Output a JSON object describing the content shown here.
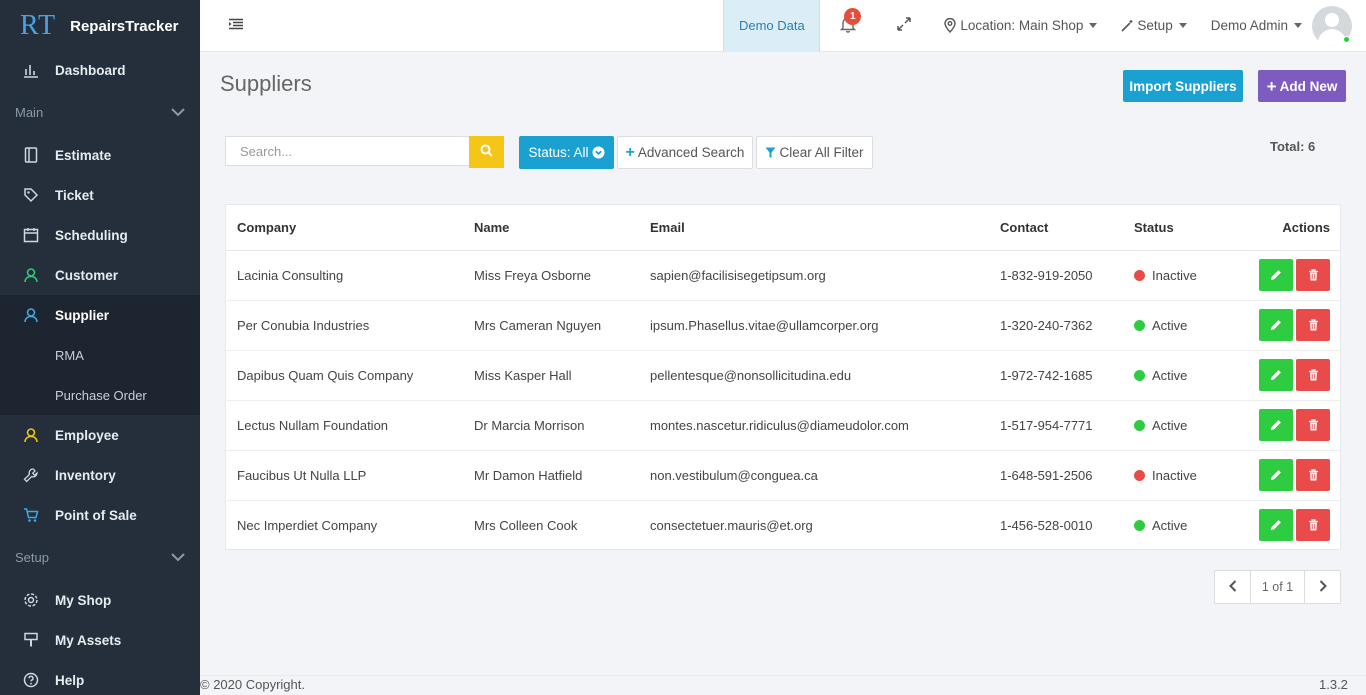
{
  "brand": {
    "mark": "RT",
    "name": "RepairsTracker"
  },
  "sidebar": {
    "dashboard": "Dashboard",
    "section_main": "Main",
    "items": [
      {
        "label": "Estimate",
        "icon": "estimate-icon"
      },
      {
        "label": "Ticket",
        "icon": "tag-icon"
      },
      {
        "label": "Scheduling",
        "icon": "calendar-icon"
      },
      {
        "label": "Customer",
        "icon": "user-icon"
      },
      {
        "label": "Supplier",
        "icon": "user-icon"
      }
    ],
    "sub_items": [
      "RMA",
      "Purchase Order"
    ],
    "items2": [
      {
        "label": "Employee",
        "icon": "users-icon"
      },
      {
        "label": "Inventory",
        "icon": "wrench-icon"
      },
      {
        "label": "Point of Sale",
        "icon": "cart-icon"
      }
    ],
    "section_setup": "Setup",
    "setup_items": [
      {
        "label": "My Shop",
        "icon": "gear-icon"
      },
      {
        "label": "My Assets",
        "icon": "brush-icon"
      },
      {
        "label": "Help",
        "icon": "help-icon"
      }
    ]
  },
  "topbar": {
    "demo_data": "Demo Data",
    "notification_count": "1",
    "location": "Location: Main Shop",
    "setup": "Setup",
    "user": "Demo Admin"
  },
  "page": {
    "title": "Suppliers",
    "import_label": "Import Suppliers",
    "add_label": "Add New",
    "search_placeholder": "Search...",
    "status_filter": "Status: All",
    "advanced_search": "Advanced Search",
    "clear_filter": "Clear All Filter",
    "total": "Total: 6"
  },
  "table": {
    "headers": [
      "Company",
      "Name",
      "Email",
      "Contact",
      "Status",
      "Actions"
    ],
    "rows": [
      {
        "company": "Lacinia Consulting",
        "name": "Miss Freya Osborne",
        "email": "sapien@facilisisegetipsum.org",
        "contact": "1-832-919-2050",
        "status": "Inactive"
      },
      {
        "company": "Per Conubia Industries",
        "name": "Mrs Cameran Nguyen",
        "email": "ipsum.Phasellus.vitae@ullamcorper.org",
        "contact": "1-320-240-7362",
        "status": "Active"
      },
      {
        "company": "Dapibus Quam Quis Company",
        "name": "Miss Kasper Hall",
        "email": "pellentesque@nonsollicitudina.edu",
        "contact": "1-972-742-1685",
        "status": "Active"
      },
      {
        "company": "Lectus Nullam Foundation",
        "name": "Dr Marcia Morrison",
        "email": "montes.nascetur.ridiculus@diameudolor.com",
        "contact": "1-517-954-7771",
        "status": "Active"
      },
      {
        "company": "Faucibus Ut Nulla LLP",
        "name": "Mr Damon Hatfield",
        "email": "non.vestibulum@conguea.ca",
        "contact": "1-648-591-2506",
        "status": "Inactive"
      },
      {
        "company": "Nec Imperdiet Company",
        "name": "Mrs Colleen Cook",
        "email": "consectetuer.mauris@et.org",
        "contact": "1-456-528-0010",
        "status": "Active"
      }
    ]
  },
  "pagination": {
    "text": "1 of 1"
  },
  "footer": {
    "copyright": "© 2020 Copyright.",
    "version": "1.3.2"
  },
  "colors": {
    "active": "#2ecc40",
    "inactive": "#e94b4b",
    "accent": "#1ba1d1",
    "add": "#7e5bbf",
    "sidebar": "#252f3b"
  }
}
